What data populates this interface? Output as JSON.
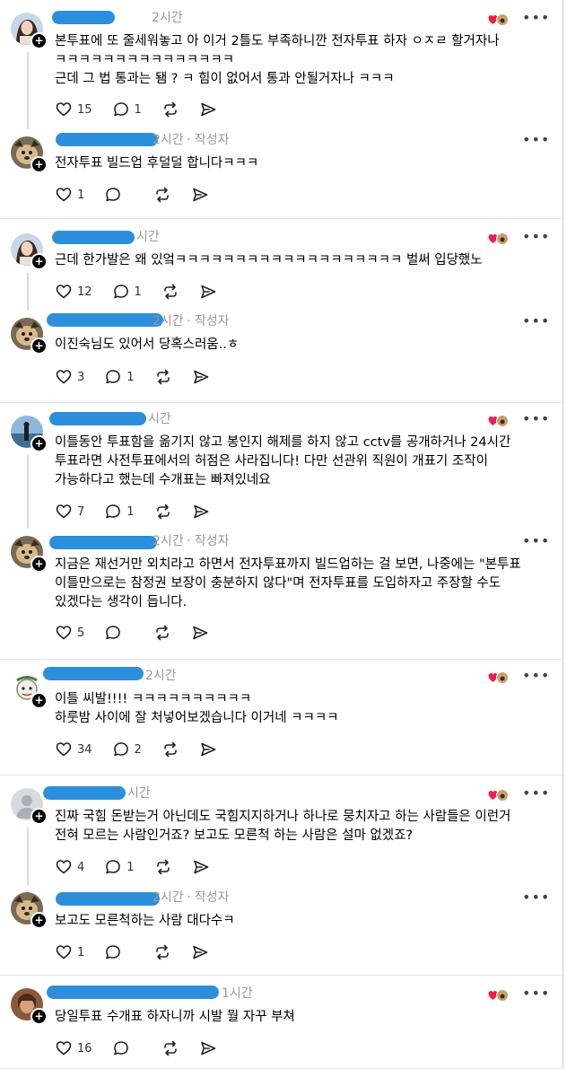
{
  "threads": [
    {
      "posts": [
        {
          "avatar": "photo-avatar",
          "time": "2시간",
          "author_tag": "",
          "text": "본투표에 또 줄세워놓고 아 이거 2틀도 부족하니깐 전자투표 하자 ㅇㅈㄹ 할거자나 ㅋㅋㅋㅋㅋㅋㅋㅋㅋㅋㅋㅋㅋㅋㅋ\n근데 그 법 통과는 됌 ? ㅋ 힘이 없어서 통과 안될거자나 ㅋㅋㅋ",
          "likes": "15",
          "replies": "1",
          "badge": true
        },
        {
          "avatar": "dog-avatar",
          "time": "2시간",
          "author_tag": "· 작성자",
          "text": "전자투표 빌드업 후덜덜 합니다ㅋㅋㅋ",
          "likes": "1",
          "replies": "",
          "badge": false
        }
      ]
    },
    {
      "posts": [
        {
          "avatar": "photo-avatar",
          "time": "시간",
          "author_tag": "",
          "text": "근데 한가발은 왜 있엌ㅋㅋㅋㅋㅋㅋㅋㅋㅋㅋㅋㅋㅋㅋㅋㅋㅋㅋㅋ 벌써 입당했노",
          "likes": "12",
          "replies": "1",
          "badge": true
        },
        {
          "avatar": "dog-avatar",
          "time": "2시간",
          "author_tag": "· 작성자",
          "text": "이진숙님도 있어서 당혹스러움..ㅎ",
          "likes": "3",
          "replies": "1",
          "badge": false
        }
      ]
    },
    {
      "posts": [
        {
          "avatar": "beach-avatar",
          "time": "시간",
          "author_tag": "",
          "text": "이틀동안 투표함을 옮기지 않고 봉인지 해제를 하지 않고 cctv를 공개하거나 24시간 투표라면 사전투표에서의 허점은 사라집니다! 다만 선관위 직원이 개표기 조작이 가능하다고 했는데 수개표는 빠져있네요",
          "likes": "7",
          "replies": "1",
          "badge": true
        },
        {
          "avatar": "dog-avatar",
          "time": "2시간",
          "author_tag": "· 작성자",
          "text": "지금은 재선거만 외치라고 하면서 전자투표까지 빌드업하는 걸 보면, 나중에는 \"본투표 이틀만으로는 참정권 보장이 충분하지 않다\"며 전자투표를 도입하자고 주장할 수도 있겠다는 생각이 듭니다.",
          "likes": "5",
          "replies": "",
          "badge": false
        }
      ]
    },
    {
      "posts": [
        {
          "avatar": "cartoon-avatar",
          "time": "2시간",
          "author_tag": "",
          "text": "이틀 씨발!!!! ㅋㅋㅋㅋㅋㅋㅋㅋㅋㅋ\n하룻밤 사이에 잘 처넣어보겠습니다 이거네 ㅋㅋㅋㅋ",
          "likes": "34",
          "replies": "2",
          "badge": true
        }
      ]
    },
    {
      "posts": [
        {
          "avatar": "default-avatar",
          "time": "시간",
          "author_tag": "",
          "text": "진짜 국힘 돈받는거 아닌데도 국힘지지하거나 하나로 뭉치자고 하는 사람들은 이런거 전혀 모르는 사람인거죠? 보고도 모른척 하는 사람은 설마 없겠죠?",
          "likes": "4",
          "replies": "1",
          "badge": true
        },
        {
          "avatar": "dog-avatar",
          "time": "2시간",
          "author_tag": "· 작성자",
          "text": "보고도 모른척하는 사람 대다수ㅋ",
          "likes": "1",
          "replies": "",
          "badge": false
        }
      ]
    },
    {
      "posts": [
        {
          "avatar": "portrait-avatar",
          "time": "1시간",
          "author_tag": "",
          "text": "당일투표 수개표 하자니까 시발 뭘 자꾸 부쳐",
          "likes": "16",
          "replies": "",
          "badge": true
        }
      ]
    }
  ]
}
